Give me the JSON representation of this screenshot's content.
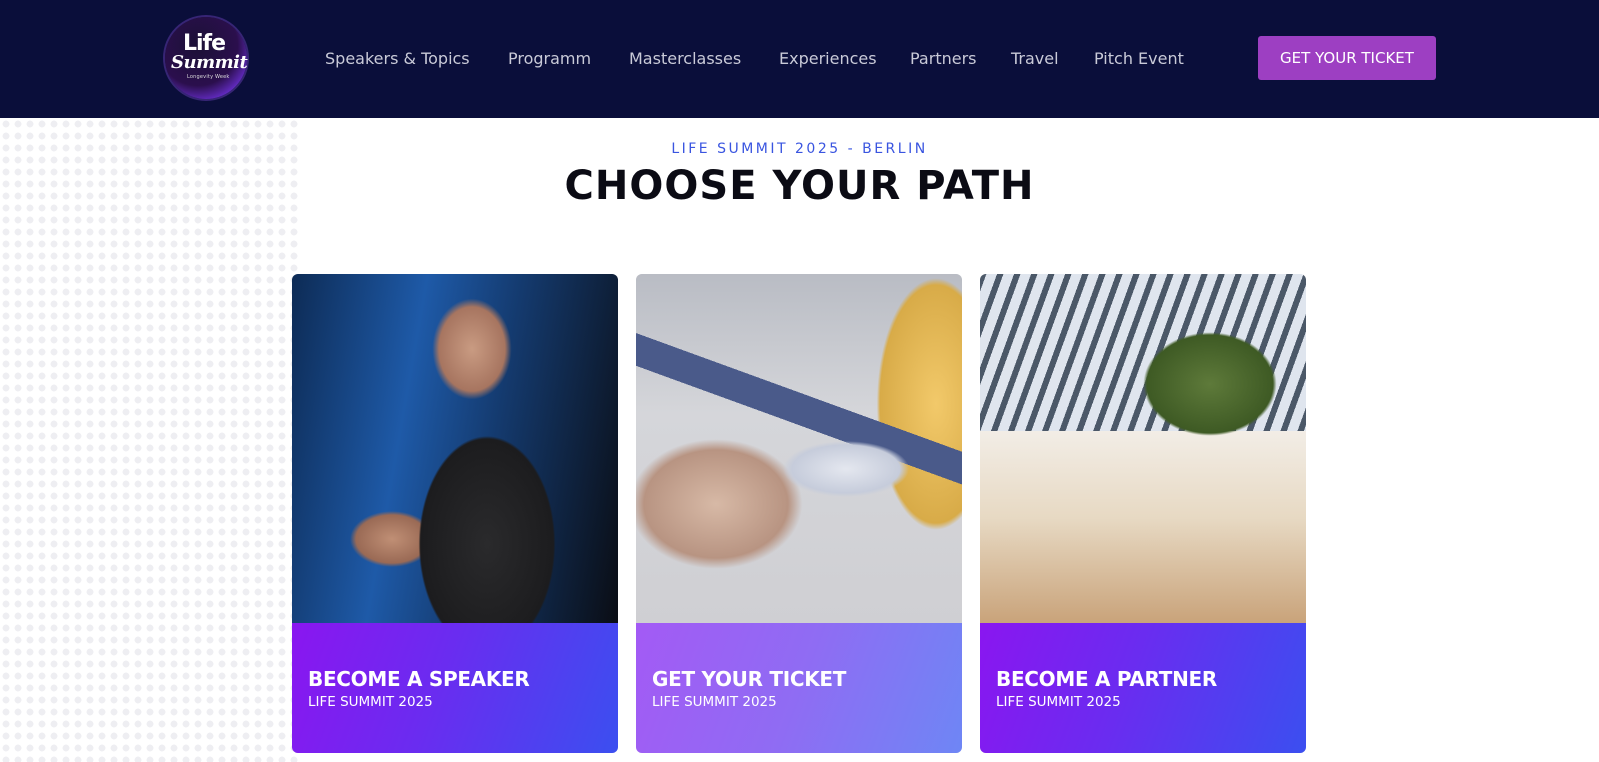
{
  "header": {
    "logo": {
      "line1": "Life",
      "line2": "Summit",
      "tagline": "Longevity Week"
    },
    "nav": [
      {
        "label": "Speakers & Topics",
        "name": "nav-speakers-topics"
      },
      {
        "label": "Programm",
        "name": "nav-programm"
      },
      {
        "label": "Masterclasses",
        "name": "nav-masterclasses"
      },
      {
        "label": "Experiences",
        "name": "nav-experiences"
      },
      {
        "label": "Partners",
        "name": "nav-partners"
      },
      {
        "label": "Travel",
        "name": "nav-travel"
      },
      {
        "label": "Pitch Event",
        "name": "nav-pitch-event"
      }
    ],
    "cta_label": "GET YOUR TICKET"
  },
  "hero": {
    "kicker": "LIFE SUMMIT 2025 - BERLIN",
    "title": "CHOOSE YOUR PATH"
  },
  "cards": [
    {
      "title": "BECOME A SPEAKER",
      "subtitle": "LIFE SUMMIT 2025"
    },
    {
      "title": "GET YOUR TICKET",
      "subtitle": "LIFE SUMMIT 2025"
    },
    {
      "title": "BECOME A PARTNER",
      "subtitle": "LIFE SUMMIT 2025"
    }
  ],
  "colors": {
    "header_bg": "#0a0e3a",
    "cta_bg": "#9d3fc2",
    "kicker": "#3a55e0",
    "heading": "#0b0b14"
  }
}
